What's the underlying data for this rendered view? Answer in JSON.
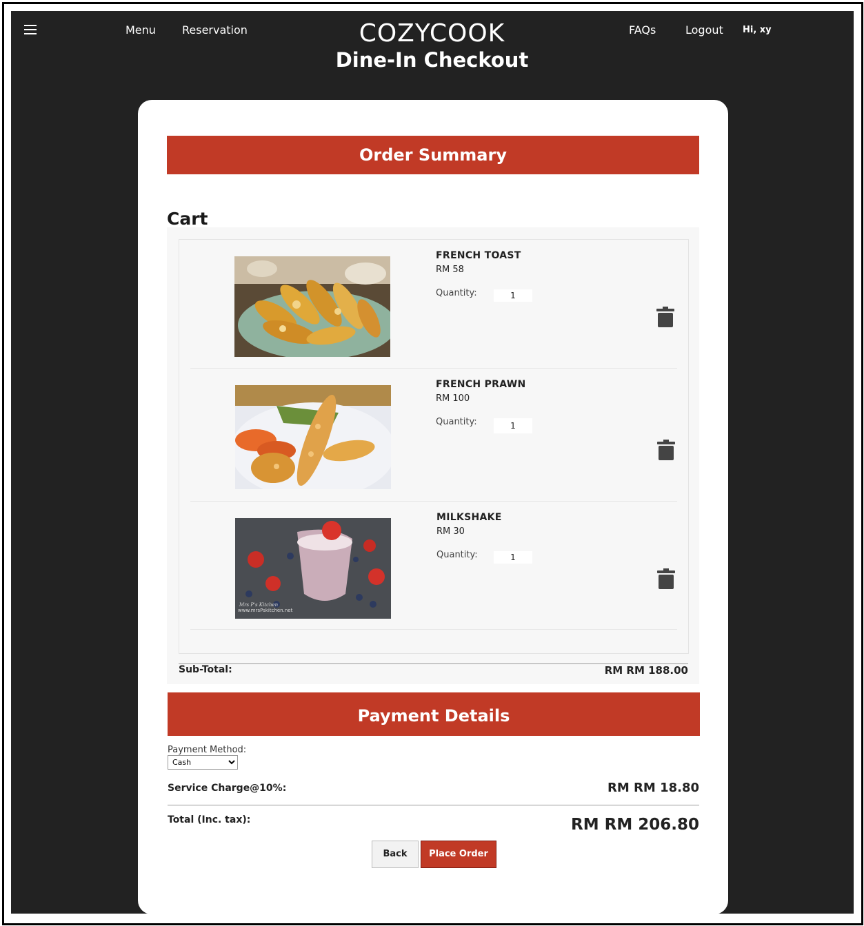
{
  "nav": {
    "menu": "Menu",
    "reservation": "Reservation",
    "faqs": "FAQs",
    "logout": "Logout",
    "greeting": "Hi, xy"
  },
  "brand": {
    "name": "COZYCOOK",
    "subtitle": "Dine-In Checkout"
  },
  "order_summary_title": "Order Summary",
  "cart": {
    "title": "Cart",
    "quantity_label": "Quantity:",
    "items": [
      {
        "name": "FRENCH TOAST",
        "price": "RM 58",
        "quantity": "1",
        "image": "french-toast-image"
      },
      {
        "name": "FRENCH PRAWN",
        "price": "RM 100",
        "quantity": "1",
        "image": "french-prawn-image"
      },
      {
        "name": "MILKSHAKE",
        "price": "RM 30",
        "quantity": "1",
        "image": "milkshake-image"
      }
    ],
    "subtotal_label": "Sub-Total:",
    "subtotal_value": "RM RM 188.00"
  },
  "payment": {
    "title": "Payment Details",
    "method_label": "Payment Method:",
    "method_options": [
      "Cash"
    ],
    "method_selected": "Cash",
    "service_label": "Service Charge@10%:",
    "service_value": "RM RM 18.80",
    "total_label": "Total (Inc. tax):",
    "total_value": "RM RM 206.80"
  },
  "buttons": {
    "back": "Back",
    "place_order": "Place Order"
  },
  "watermark": "Mrs P's Kitchen www.mrsPskitchen.net",
  "colors": {
    "accent": "#c13a26",
    "background": "#222222",
    "card": "#ffffff"
  }
}
